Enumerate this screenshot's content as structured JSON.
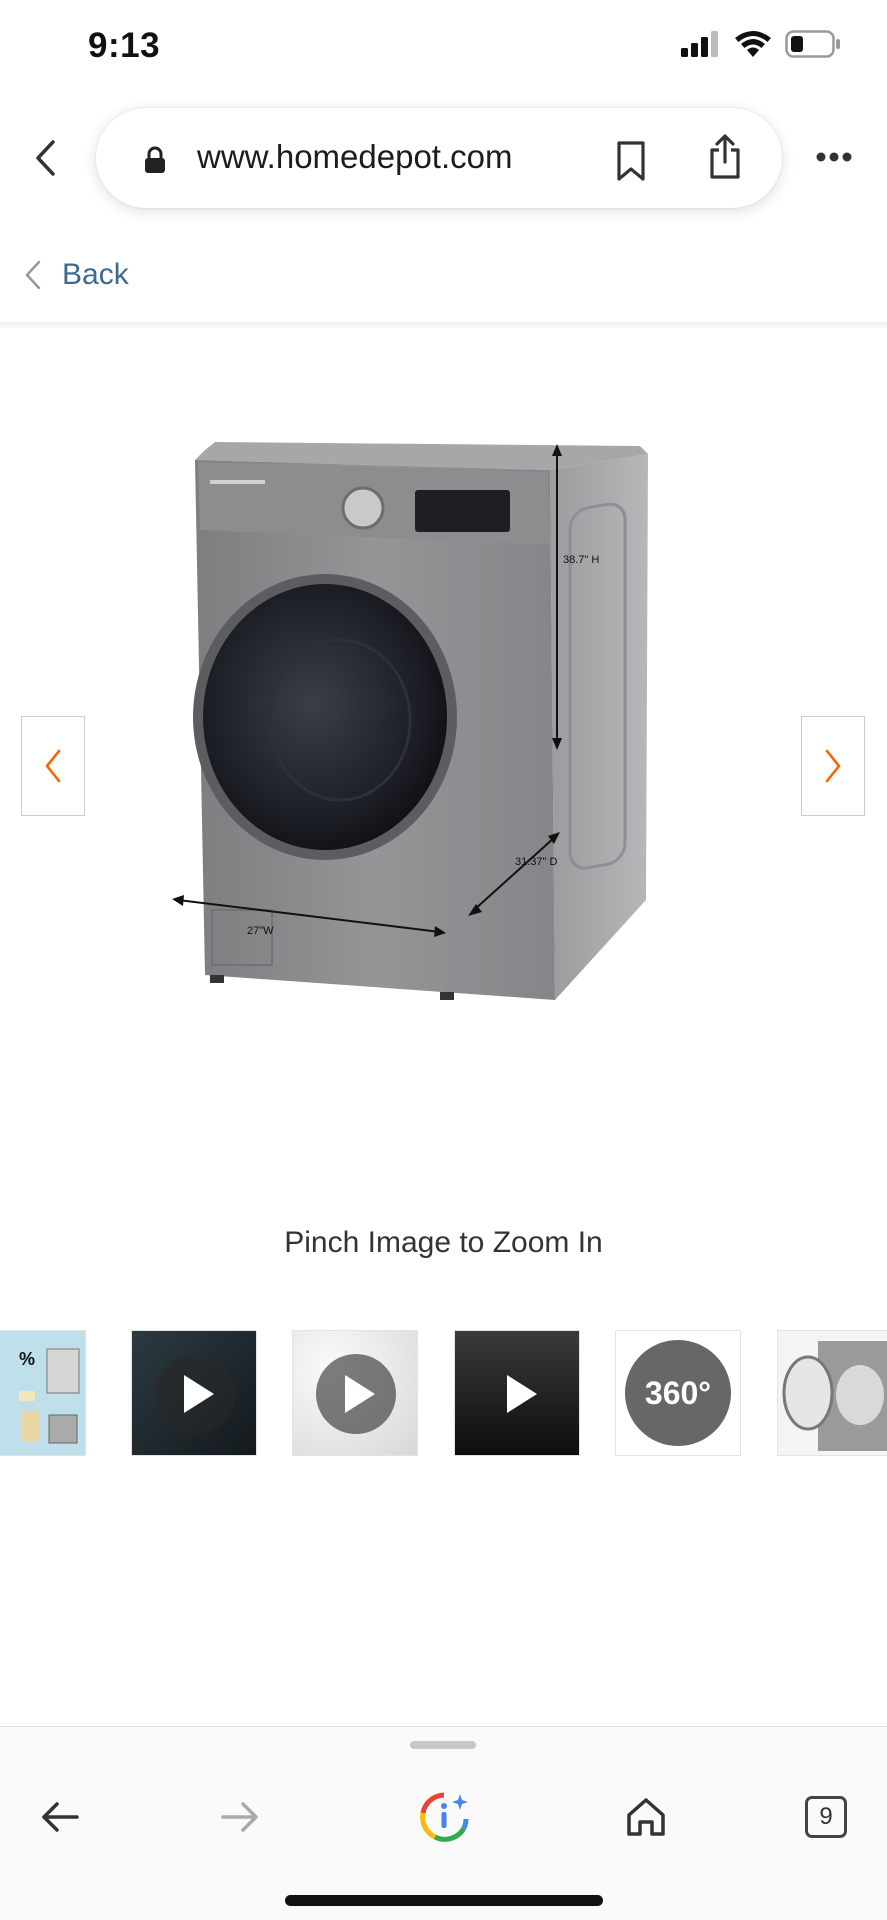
{
  "status_bar": {
    "time": "9:13",
    "signal_icon": "cellular-signal-icon",
    "wifi_icon": "wifi-icon",
    "battery_icon": "battery-low-icon"
  },
  "browser": {
    "url": "www.homedepot.com",
    "icons": [
      "chevron-left-icon",
      "lock-icon",
      "bookmark-icon",
      "share-icon",
      "more-icon"
    ]
  },
  "page": {
    "back_label": "Back",
    "product_image": {
      "dimensions": {
        "height": "38.7\" H",
        "depth": "31.37\" D",
        "width": "27\"W"
      }
    },
    "zoom_hint": "Pinch Image to Zoom In",
    "thumbnails": [
      {
        "kind": "image",
        "name": "promo"
      },
      {
        "kind": "video",
        "name": "phone-app"
      },
      {
        "kind": "video",
        "name": "fabric"
      },
      {
        "kind": "video",
        "name": "detail"
      },
      {
        "kind": "spin",
        "label": "360°"
      },
      {
        "kind": "image",
        "name": "open-door"
      }
    ]
  },
  "toolbar": {
    "tab_count": "9",
    "icons": [
      "back-arrow-icon",
      "forward-arrow-icon",
      "google-lens-icon",
      "home-icon",
      "tabs-icon"
    ]
  },
  "colors": {
    "accent_orange": "#f96302",
    "link_blue": "#3d6a8e",
    "appliance_silver": "#8a8a8c"
  }
}
